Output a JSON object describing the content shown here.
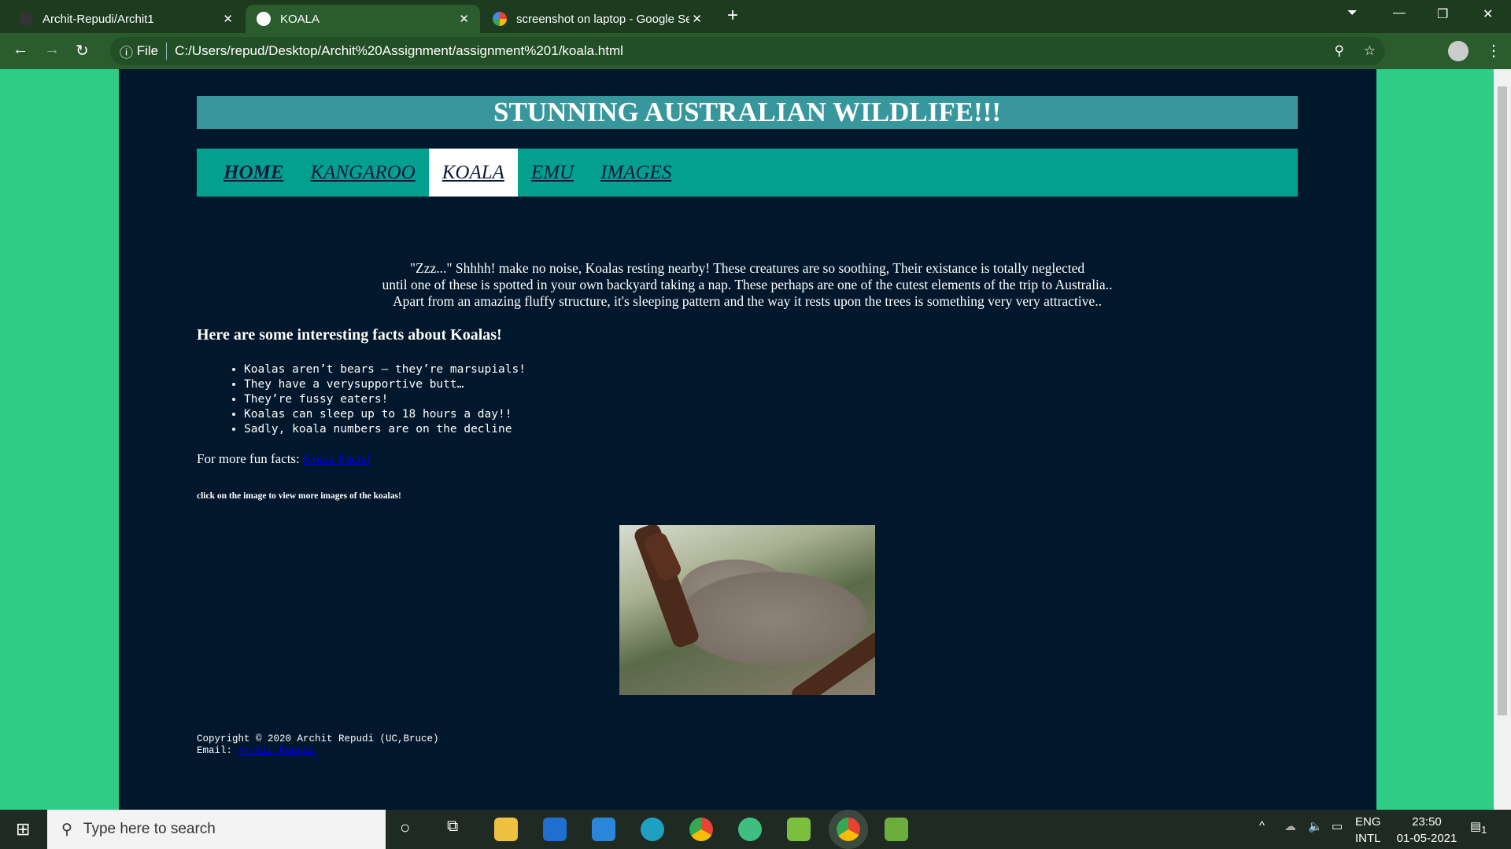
{
  "browser": {
    "tabs": [
      {
        "title": "Archit-Repudi/Archit1",
        "icon": "github-icon"
      },
      {
        "title": "KOALA",
        "icon": "globe-icon",
        "active": true
      },
      {
        "title": "screenshot on laptop - Google Se",
        "icon": "google-icon"
      }
    ],
    "url_prefix": "File",
    "url": "C:/Users/repud/Desktop/Archit%20Assignment/assignment%201/koala.html"
  },
  "page": {
    "title": "STUNNING AUSTRALIAN WILDLIFE!!!",
    "nav": [
      "HOME",
      "KANGAROO",
      "KOALA",
      "EMU",
      "IMAGES"
    ],
    "active_nav": "KOALA",
    "intro": [
      "\"Zzz...\" Shhhh! make no noise, Koalas resting nearby! These creatures are so soothing, Their existance is totally neglected",
      "until one of these is spotted in your own backyard taking a nap. These perhaps are one of the cutest elements of the trip to Australia..",
      "Apart from an amazing fluffy structure, it's sleeping pattern and the way it rests upon the trees is something very very attractive.."
    ],
    "facts_heading": "Here are some interesting facts about Koalas!",
    "facts": [
      "Koalas aren’t bears – they’re marsupials!",
      "They have a verysupportive butt…",
      "They’re fussy eaters!",
      "Koalas can sleep up to 18 hours a day!!",
      "Sadly, koala numbers are on the decline"
    ],
    "more_label": "For more fun facts:",
    "more_link": "Koala Facts!",
    "click_note": "click on the image to view more images of the koalas!",
    "copyright": "Copyright © 2020 Archit Repudi (UC,Bruce)",
    "email_label": "Email:",
    "email_link": "Archit Repudi"
  },
  "taskbar": {
    "search_placeholder": "Type here to search",
    "lang1": "ENG",
    "lang2": "INTL",
    "time": "23:50",
    "date": "01-05-2021",
    "notifications": "1"
  },
  "colors": {
    "page_bg": "#01172b",
    "side_bg": "#2ecc87",
    "banner": "#37979c",
    "nav": "#03a08e"
  }
}
